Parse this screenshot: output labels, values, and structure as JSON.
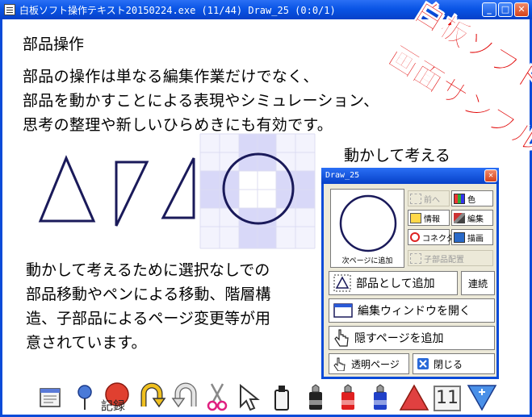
{
  "window": {
    "title": "白板ソフト操作テキスト20150224.exe (11/44) Draw_25 (0:0/1)",
    "controls": {
      "minimize": "_",
      "maximize": "□",
      "close": "✕"
    }
  },
  "content": {
    "heading": "部品操作",
    "paragraph": [
      "部品の操作は単なる編集作業だけでなく、",
      "部品を動かすことによる表現やシミュレーション、",
      "思考の整理や新しいひらめきにも有効です。"
    ],
    "move_think": "動かして考える",
    "body2": [
      "動かして考えるために選択なしでの",
      "部品移動やペンによる移動、階層構",
      "造、子部品によるページ変更等が用",
      "意されています。"
    ]
  },
  "stamp": {
    "line1": "白板ソフト",
    "line2": "画面サンプル"
  },
  "dialog": {
    "title": "Draw_25",
    "close": "✕",
    "preview_caption": "次ページに追加",
    "buttons": {
      "prev": "前へ",
      "color": "色",
      "info": "情報",
      "edit": "編集",
      "connector": "コネクタ",
      "draw": "描画",
      "child_layout": "子部品配置",
      "add_as_part": "部品として追加",
      "continuous": "連続",
      "open_edit_window": "編集ウィンドウを開く",
      "add_hidden_page": "隠すページを追加",
      "transparent_page": "透明ページ",
      "close_dialog": "閉じる"
    }
  },
  "toolbar": {
    "record_label": "記録",
    "page_number": "11"
  },
  "colors": {
    "title_blue": "#0a55e6",
    "stamp_red": "#e00000",
    "shape_navy": "#1a1a5a",
    "grid_tint": "#d8d8f8"
  }
}
